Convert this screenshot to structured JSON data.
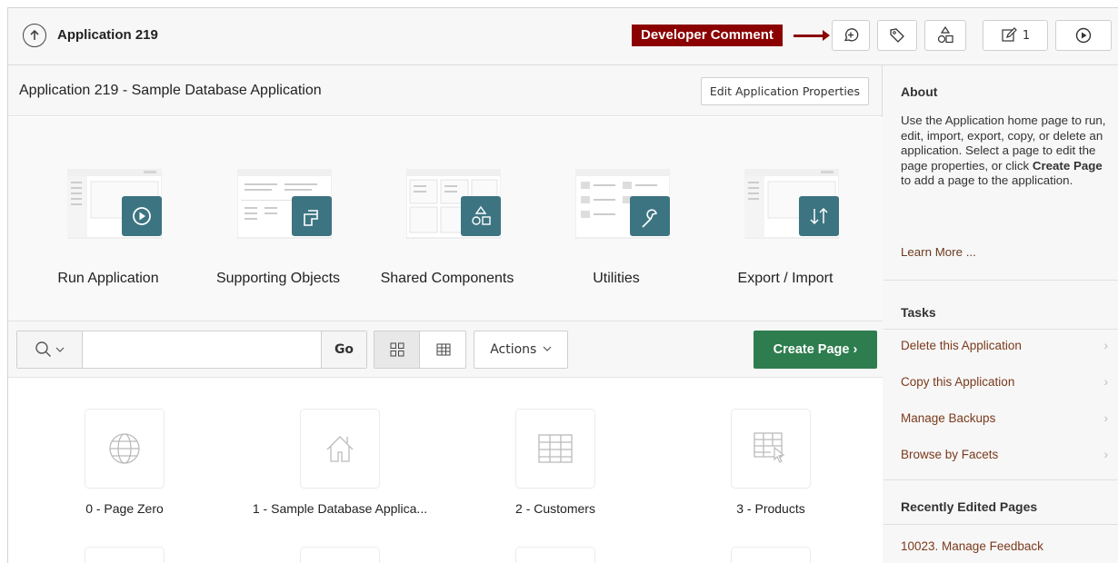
{
  "topbar": {
    "app_title": "Application 219",
    "callout": "Developer Comment",
    "edit_count": "1"
  },
  "main": {
    "title": "Application 219 - Sample Database Application",
    "edit_properties_label": "Edit Application Properties",
    "tiles": [
      {
        "label": "Run Application",
        "icon": "play-icon"
      },
      {
        "label": "Supporting Objects",
        "icon": "supporting-objects-icon"
      },
      {
        "label": "Shared Components",
        "icon": "shared-components-icon"
      },
      {
        "label": "Utilities",
        "icon": "wrench-icon"
      },
      {
        "label": "Export / Import",
        "icon": "export-import-icon"
      }
    ]
  },
  "search": {
    "value": "",
    "go_label": "Go",
    "actions_label": "Actions",
    "create_label": "Create Page"
  },
  "pages": [
    {
      "label": "0 - Page Zero",
      "icon": "globe-icon"
    },
    {
      "label": "1 - Sample Database Applica...",
      "icon": "home-icon"
    },
    {
      "label": "2 - Customers",
      "icon": "table-icon"
    },
    {
      "label": "3 - Products",
      "icon": "table-cursor-icon"
    }
  ],
  "sidebar": {
    "about_heading": "About",
    "about_text_1": "Use the Application home page to run, edit, import, export, copy, or delete an application. Select a page to edit the page properties, or click ",
    "about_bold": "Create Page",
    "about_text_2": " to add a page to the application.",
    "learn_more": "Learn More ...",
    "tasks_heading": "Tasks",
    "tasks": [
      "Delete this Application",
      "Copy this Application",
      "Manage Backups",
      "Browse by Facets"
    ],
    "recent_heading": "Recently Edited Pages",
    "recent": [
      "10023. Manage Feedback"
    ]
  },
  "colors": {
    "callout": "#8b0000",
    "tile_icon": "#3d7482",
    "create_button": "#2e7d4f",
    "link": "#7a3a1c"
  }
}
